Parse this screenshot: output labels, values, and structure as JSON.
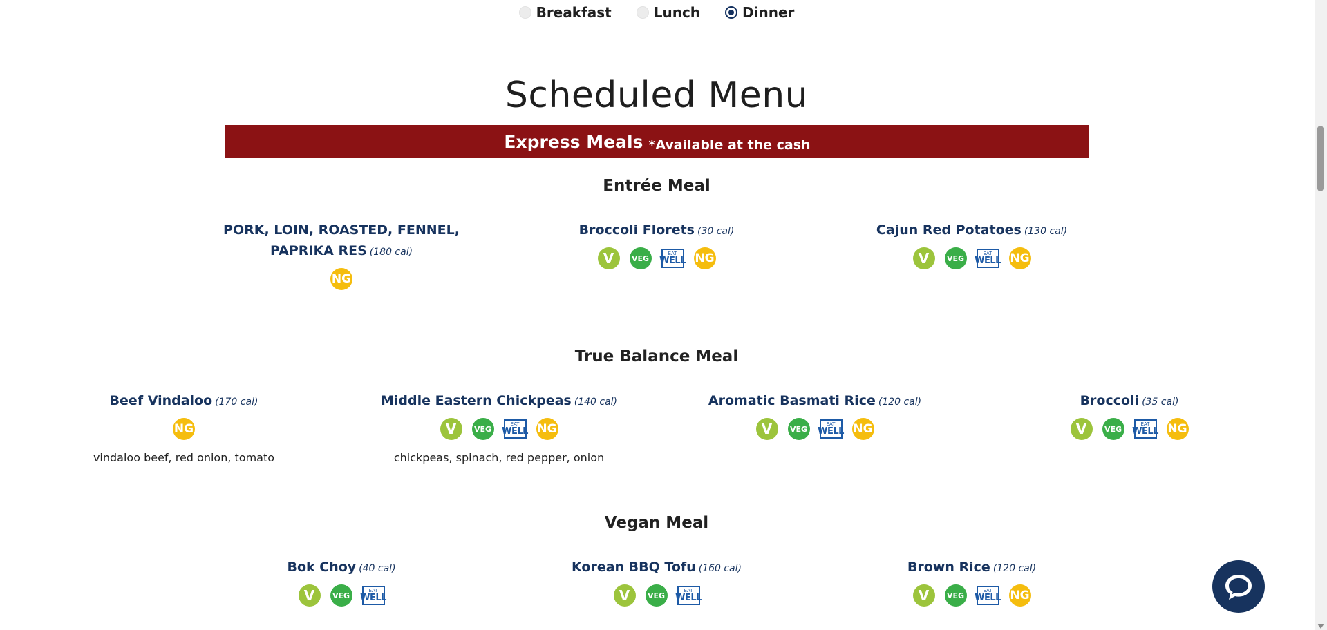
{
  "meal_periods": [
    {
      "label": "Breakfast",
      "selected": false
    },
    {
      "label": "Lunch",
      "selected": false
    },
    {
      "label": "Dinner",
      "selected": true
    }
  ],
  "page_title": "Scheduled Menu",
  "banner": {
    "title": "Express Meals",
    "note": "*Available at the cash",
    "color": "#8b1214"
  },
  "badge_labels": {
    "vegan": "V",
    "vegetarian": "VEG",
    "eat_well_top": "EAT",
    "eat_well_bottom": "WELL",
    "no_gluten": "NG"
  },
  "sections": [
    {
      "title": "Entrée Meal",
      "items": [
        {
          "name": "PORK, LOIN, ROASTED, FENNEL, PAPRIKA RES",
          "calories": "(180 cal)",
          "badges": [
            "ng"
          ],
          "ingredients": ""
        },
        {
          "name": "Broccoli Florets",
          "calories": "(30 cal)",
          "badges": [
            "v",
            "veg",
            "eatwell",
            "ng"
          ],
          "ingredients": ""
        },
        {
          "name": "Cajun Red Potatoes",
          "calories": "(130 cal)",
          "badges": [
            "v",
            "veg",
            "eatwell",
            "ng"
          ],
          "ingredients": ""
        }
      ]
    },
    {
      "title": "True Balance Meal",
      "items": [
        {
          "name": "Beef Vindaloo",
          "calories": "(170 cal)",
          "badges": [
            "ng"
          ],
          "ingredients": "vindaloo beef, red onion, tomato"
        },
        {
          "name": "Middle Eastern Chickpeas",
          "calories": "(140 cal)",
          "badges": [
            "v",
            "veg",
            "eatwell",
            "ng"
          ],
          "ingredients": "chickpeas, spinach, red pepper, onion"
        },
        {
          "name": "Aromatic Basmati Rice",
          "calories": "(120 cal)",
          "badges": [
            "v",
            "veg",
            "eatwell",
            "ng"
          ],
          "ingredients": ""
        },
        {
          "name": "Broccoli",
          "calories": "(35 cal)",
          "badges": [
            "v",
            "veg",
            "eatwell",
            "ng"
          ],
          "ingredients": ""
        }
      ]
    },
    {
      "title": "Vegan Meal",
      "items": [
        {
          "name": "Bok Choy",
          "calories": "(40 cal)",
          "badges": [
            "v",
            "veg",
            "eatwell"
          ],
          "ingredients": ""
        },
        {
          "name": "Korean BBQ Tofu",
          "calories": "(160 cal)",
          "badges": [
            "v",
            "veg",
            "eatwell"
          ],
          "ingredients": ""
        },
        {
          "name": "Brown Rice",
          "calories": "(120 cal)",
          "badges": [
            "v",
            "veg",
            "eatwell",
            "ng"
          ],
          "ingredients": ""
        }
      ]
    }
  ],
  "chat_button": {
    "icon": "chat-bubble-icon"
  },
  "colors": {
    "navy": "#17335e",
    "vegan": "#9cc43c",
    "vegetarian": "#3aae48",
    "no_gluten": "#f5bd0e",
    "eat_well": "#1d5aa6"
  }
}
